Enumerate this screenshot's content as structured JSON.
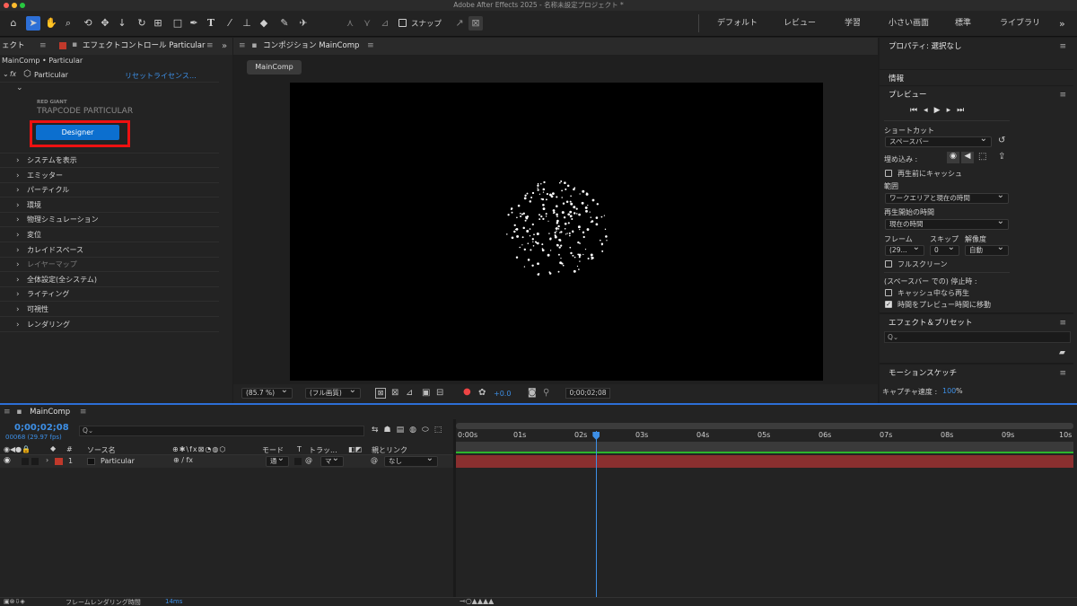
{
  "app": {
    "title": "Adobe After Effects 2025 - 名称未設定プロジェクト *"
  },
  "toolbar": {
    "snap_label": "スナップ",
    "workspaces": [
      "デフォルト",
      "レビュー",
      "学習",
      "小さい画面",
      "標準",
      "ライブラリ"
    ]
  },
  "effects_panel": {
    "tab_prefix": "ェクト",
    "tab_label": "エフェクトコントロール Particular",
    "breadcrumb": "MainComp • Particular",
    "effect_name": "Particular",
    "fx_label": "fx",
    "reset_label": "リセット",
    "license_label": "ライセンス…",
    "brand_small": "RED GIANT",
    "brand_large": "TRAPCODE PARTICULAR",
    "designer_button": "Designer",
    "sections": [
      "システムを表示",
      "エミッター",
      "パーティクル",
      "環境",
      "物理シミュレーション",
      "変位",
      "カレイドスペース",
      "レイヤーマップ",
      "全体設定(全システム)",
      "ライティング",
      "可視性",
      "レンダリング"
    ]
  },
  "composition": {
    "tab_label": "コンポジション MainComp",
    "sub_tab": "MainComp",
    "zoom": "(85.7 %)",
    "quality": "(フル画質)",
    "exposure": "+0.0",
    "timecode": "0;00;02;08"
  },
  "right_panel": {
    "properties": "プロパティ: 選択なし",
    "info": "情報",
    "preview_title": "プレビュー",
    "shortcut_label": "ショートカット",
    "shortcut_value": "スペースバー",
    "embed_label": "埋め込み :",
    "cache_before": "再生前にキャッシュ",
    "range_label": "範囲",
    "range_value": "ワークエリアと現在の時間",
    "start_label": "再生開始の時間",
    "start_value": "現在の時間",
    "frame_label": "フレーム",
    "skip_label": "スキップ",
    "resolution_label": "解像度",
    "frame_value": "(29...",
    "skip_value": "0",
    "resolution_value": "自動",
    "fullscreen": "フルスクリーン",
    "stop_label": "(スペースバー での) 停止時 :",
    "stop_opt1": "キャッシュ中なら再生",
    "stop_opt2": "時間をプレビュー時間に移動",
    "effects_presets": "エフェクト＆プリセット",
    "search_placeholder": "Q⌄",
    "motion_sketch": "モーションスケッチ",
    "capture_label": "キャプチャ速度 :",
    "capture_value": "100",
    "capture_unit": "%"
  },
  "timeline": {
    "tab_label": "MainComp",
    "timecode": "0;00;02;08",
    "frames": "00068 (29.97 fps)",
    "search_placeholder": "Q⌄",
    "col_num": "#",
    "col_source": "ソース名",
    "col_mode": "モード",
    "col_t": "T",
    "col_track": "トラッ...",
    "col_parent": "親とリンク",
    "layer_index": "1",
    "layer_name": "Particular",
    "layer_mode": "通",
    "parent_value": "なし",
    "ticks": [
      "0:00s",
      "01s",
      "02s",
      "03s",
      "04s",
      "05s",
      "06s",
      "07s",
      "08s",
      "09s",
      "10s"
    ],
    "render_time_label": "フレームレンダリング時間",
    "render_time_value": "14ms",
    "playhead_fraction": 0.227
  }
}
